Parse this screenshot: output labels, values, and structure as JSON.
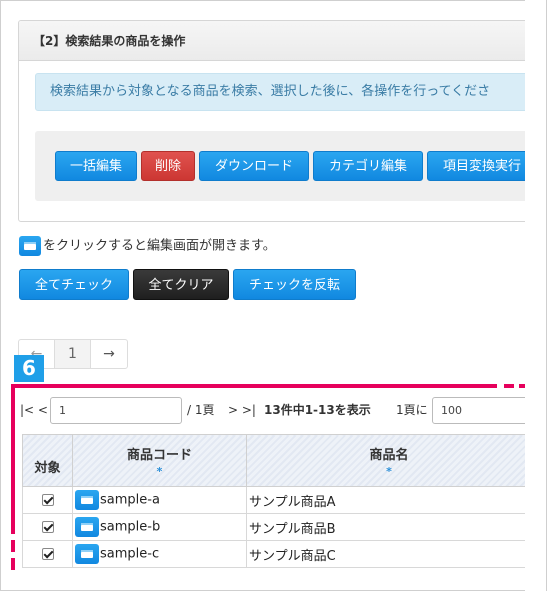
{
  "panel": {
    "title": "【2】検索結果の商品を操作",
    "info": "検索結果から対象となる商品を検索、選択した後に、各操作を行ってくださ"
  },
  "actions": {
    "bulk_edit": "一括編集",
    "delete": "削除",
    "download": "ダウンロード",
    "category_edit": "カテゴリ編集",
    "item_convert": "項目変換実行"
  },
  "hint_text": "をクリックすると編集画面が開きます。",
  "selection": {
    "check_all": "全てチェック",
    "clear_all": "全てクリア",
    "invert": "チェックを反転"
  },
  "pagination": {
    "prev": "←",
    "current": "1",
    "next": "→"
  },
  "badge": "6",
  "toolbar": {
    "first": "|< <",
    "page_value": "1",
    "total_pages": "/ 1頁",
    "last": "> >|",
    "summary": "13件中1-13を表示",
    "per_page_label": "1頁に",
    "per_page_value": "100"
  },
  "table": {
    "headers": {
      "target": "対象",
      "code": "商品コード",
      "name": "商品名",
      "sort_mark": "*"
    },
    "rows": [
      {
        "code": "sample-a",
        "name": "サンプル商品A",
        "checked": true
      },
      {
        "code": "sample-b",
        "name": "サンプル商品B",
        "checked": true
      },
      {
        "code": "sample-c",
        "name": "サンプル商品C",
        "checked": true
      }
    ]
  },
  "colors": {
    "primary": "#1a96e8",
    "danger": "#d9443f",
    "dark": "#222222",
    "annotation": "#e6005c",
    "info_bg": "#d9edf7"
  }
}
